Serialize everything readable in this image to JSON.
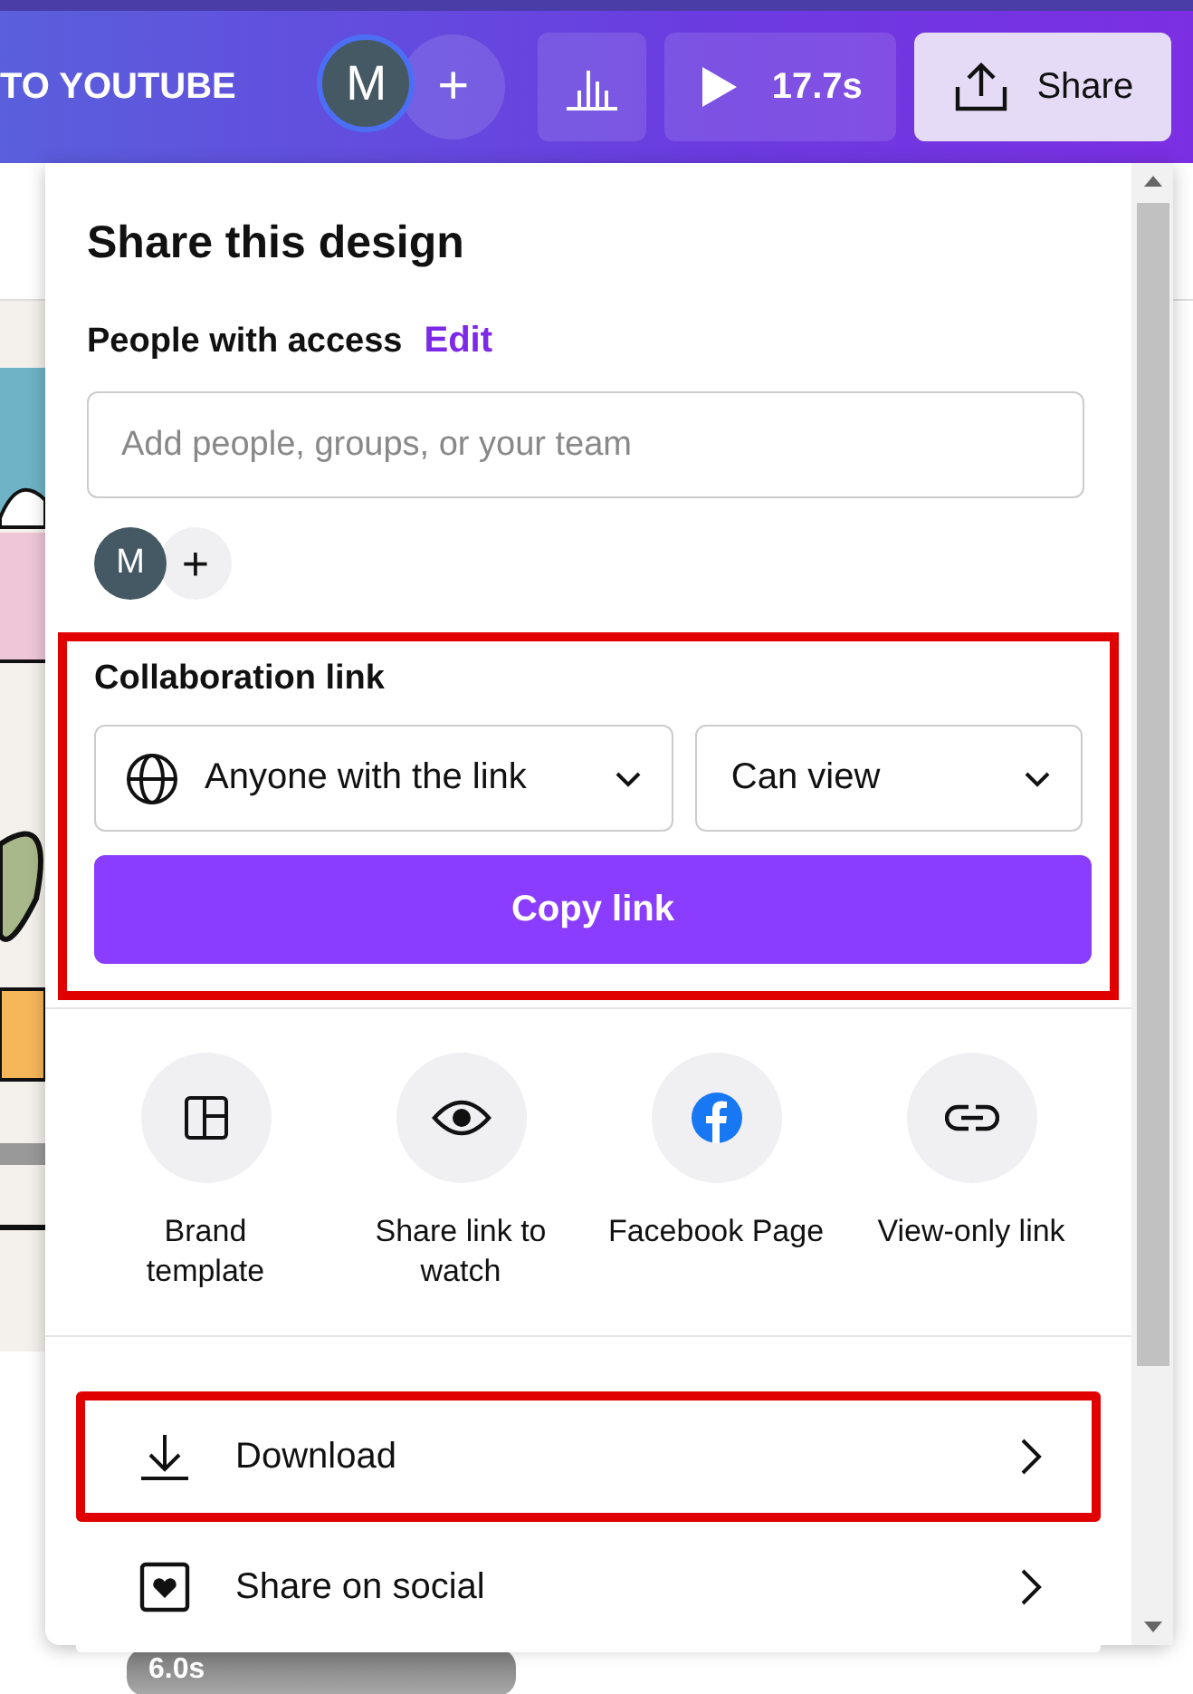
{
  "topbar": {
    "title": "TO YOUTUBE",
    "avatar": "M",
    "add": "+",
    "duration": "17.7s",
    "share": "Share"
  },
  "share_panel": {
    "title": "Share this design",
    "access_label": "People with access",
    "edit": "Edit",
    "add_people": {
      "placeholder": "Add people, groups, or your team"
    },
    "members": [
      {
        "initial": "M"
      }
    ],
    "add_member": "+",
    "collab_highlighted": true,
    "collab_label": "Collaboration link",
    "access_select": "Anyone with the link",
    "permission_select": "Can view",
    "copy": "Copy link",
    "options": [
      {
        "kind": "brand",
        "label": "Brand\ntemplate"
      },
      {
        "kind": "watch",
        "label": "Share link to\nwatch"
      },
      {
        "kind": "facebook",
        "label": "Facebook Page"
      },
      {
        "kind": "link",
        "label": "View-only link"
      }
    ],
    "actions": [
      {
        "kind": "download",
        "label": "Download",
        "highlighted": true
      },
      {
        "kind": "social",
        "label": "Share on social",
        "highlighted": false
      }
    ]
  },
  "thumbnail": {
    "duration": "6.0s"
  }
}
